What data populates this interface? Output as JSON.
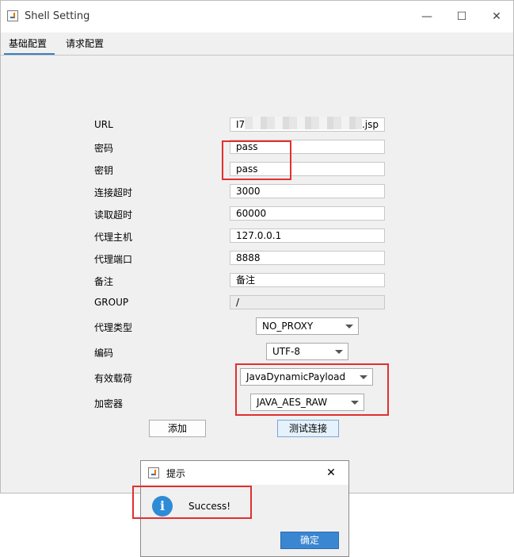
{
  "window": {
    "title": "Shell Setting",
    "controls": {
      "minimize": "—",
      "maximize": "☐",
      "close": "✕"
    }
  },
  "tabs": [
    {
      "label": "基础配置"
    },
    {
      "label": "请求配置"
    }
  ],
  "form": {
    "url": {
      "label": "URL",
      "value_start": "I7",
      "value_end": "l.jsp"
    },
    "password": {
      "label": "密码",
      "value": "pass"
    },
    "key": {
      "label": "密钥",
      "value": "pass"
    },
    "conn_timeout": {
      "label": "连接超时",
      "value": "3000"
    },
    "read_timeout": {
      "label": "读取超时",
      "value": "60000"
    },
    "proxy_host": {
      "label": "代理主机",
      "value": "127.0.0.1"
    },
    "proxy_port": {
      "label": "代理端口",
      "value": "8888"
    },
    "remark": {
      "label": "备注",
      "value": "备注"
    },
    "group": {
      "label": "GROUP",
      "value": "/"
    },
    "proxy_type": {
      "label": "代理类型",
      "value": "NO_PROXY"
    },
    "encoding": {
      "label": "编码",
      "value": "UTF-8"
    },
    "payload": {
      "label": "有效载荷",
      "value": "JavaDynamicPayload"
    },
    "cryption": {
      "label": "加密器",
      "value": "JAVA_AES_RAW"
    }
  },
  "buttons": {
    "add": "添加",
    "test": "测试连接"
  },
  "dialog": {
    "title": "提示",
    "message": "Success!",
    "ok": "确定",
    "close": "✕",
    "info_glyph": "i"
  },
  "colors": {
    "highlight": "#e03030",
    "accent": "#3c7fc1",
    "info": "#2e8bd6"
  }
}
